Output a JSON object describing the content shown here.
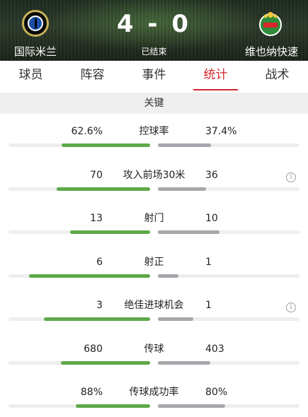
{
  "match": {
    "home_team": "国际米兰",
    "away_team": "维也纳快速",
    "score": "4 - 0",
    "status": "已结束"
  },
  "tabs": [
    {
      "label": "球员",
      "active": false
    },
    {
      "label": "阵容",
      "active": false
    },
    {
      "label": "事件",
      "active": false
    },
    {
      "label": "统计",
      "active": true
    },
    {
      "label": "战术",
      "active": false
    }
  ],
  "section": {
    "title": "关键"
  },
  "colors": {
    "accent": "#d3262b",
    "home_bar": "#5ea84a",
    "away_bar": "#a6a6ab"
  },
  "stats": [
    {
      "label": "控球率",
      "home": "62.6%",
      "away": "37.4%",
      "home_fill": 0.626,
      "away_fill": 0.374,
      "info": false
    },
    {
      "label": "攻入前场30米",
      "home": "70",
      "away": "36",
      "home_fill": 0.66,
      "away_fill": 0.34,
      "info": true
    },
    {
      "label": "射门",
      "home": "13",
      "away": "10",
      "home_fill": 0.565,
      "away_fill": 0.435,
      "info": false
    },
    {
      "label": "射正",
      "home": "6",
      "away": "1",
      "home_fill": 0.857,
      "away_fill": 0.143,
      "info": false
    },
    {
      "label": "绝佳进球机会",
      "home": "3",
      "away": "1",
      "home_fill": 0.75,
      "away_fill": 0.25,
      "info": true
    },
    {
      "label": "传球",
      "home": "680",
      "away": "403",
      "home_fill": 0.628,
      "away_fill": 0.372,
      "info": false
    },
    {
      "label": "传球成功率",
      "home": "88%",
      "away": "80%",
      "home_fill": 0.524,
      "away_fill": 0.476,
      "info": false
    }
  ],
  "info_icon_glyph": "i"
}
